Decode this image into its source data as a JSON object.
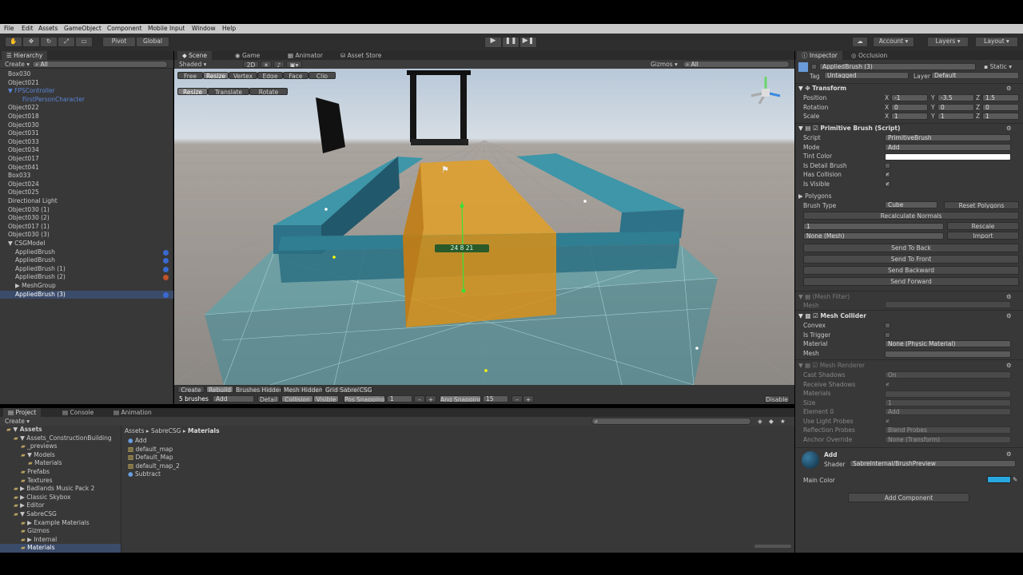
{
  "menu": [
    "File",
    "Edit",
    "Assets",
    "GameObject",
    "Component",
    "Mobile Input",
    "Window",
    "Help"
  ],
  "toolbar": {
    "pivot": "Pivot",
    "global": "Global",
    "account": "Account",
    "layers": "Layers",
    "layout": "Layout"
  },
  "hierarchy": {
    "tab": "Hierarchy",
    "create": "Create",
    "search_placeholder": "All",
    "items": [
      {
        "label": "Box030",
        "indent": 0,
        "style": "normal"
      },
      {
        "label": "Object021",
        "indent": 0,
        "style": "normal"
      },
      {
        "label": "▼ FPSController",
        "indent": 0,
        "style": "blue"
      },
      {
        "label": "FirstPersonCharacter",
        "indent": 2,
        "style": "blue"
      },
      {
        "label": "Object022",
        "indent": 0,
        "style": "normal"
      },
      {
        "label": "Object018",
        "indent": 0,
        "style": "normal"
      },
      {
        "label": "Object030",
        "indent": 0,
        "style": "normal"
      },
      {
        "label": "Object031",
        "indent": 0,
        "style": "normal"
      },
      {
        "label": "Object033",
        "indent": 0,
        "style": "normal"
      },
      {
        "label": "Object034",
        "indent": 0,
        "style": "normal"
      },
      {
        "label": "Object017",
        "indent": 0,
        "style": "normal"
      },
      {
        "label": "Object041",
        "indent": 0,
        "style": "normal"
      },
      {
        "label": "Box033",
        "indent": 0,
        "style": "normal"
      },
      {
        "label": "Object024",
        "indent": 0,
        "style": "normal"
      },
      {
        "label": "Object025",
        "indent": 0,
        "style": "normal"
      },
      {
        "label": "Directional Light",
        "indent": 0,
        "style": "normal"
      },
      {
        "label": "Object030 (1)",
        "indent": 0,
        "style": "normal"
      },
      {
        "label": "Object030 (2)",
        "indent": 0,
        "style": "normal"
      },
      {
        "label": "Object017 (1)",
        "indent": 0,
        "style": "normal"
      },
      {
        "label": "Object030 (3)",
        "indent": 0,
        "style": "normal"
      },
      {
        "label": "▼ CSGModel",
        "indent": 0,
        "style": "normal"
      },
      {
        "label": "AppliedBrush",
        "indent": 1,
        "style": "normal"
      },
      {
        "label": "AppliedBrush",
        "indent": 1,
        "style": "normal"
      },
      {
        "label": "AppliedBrush (1)",
        "indent": 1,
        "style": "normal"
      },
      {
        "label": "AppliedBrush (2)",
        "indent": 1,
        "style": "normal"
      },
      {
        "label": "▶ MeshGroup",
        "indent": 1,
        "style": "normal"
      },
      {
        "label": "AppliedBrush (3)",
        "indent": 1,
        "style": "selected"
      }
    ]
  },
  "scene": {
    "tabs": [
      "Scene",
      "Game",
      "Animator",
      "Asset Store"
    ],
    "shading": "Shaded",
    "mode_2d": "2D",
    "gizmos": "Gizmos",
    "search_placeholder": "All",
    "mode_tabs": [
      "Free",
      "Resize",
      "Vertex",
      "Edge",
      "Face",
      "Clip"
    ],
    "mode_tabs2": [
      "Resize",
      "Translate",
      "Rotate"
    ],
    "dimension_label": "24 8 21",
    "bottom_bar": [
      "Create",
      "Rebuild",
      "Brushes Hidden",
      "Mesh Hidden",
      "Grid Sabre(CSG)"
    ],
    "bottom_bar2": {
      "brushes": "5 brushes",
      "add": "Add",
      "detail": "Detail",
      "collision": "Collision",
      "visible": "Visible",
      "pos_snapping": "Pos Snapping",
      "pos_value": "1",
      "ang_snapping": "Ang Snapping",
      "ang_value": "15",
      "disable": "Disable"
    }
  },
  "project": {
    "tabs": [
      "Project",
      "Console",
      "Animation"
    ],
    "create": "Create",
    "breadcrumb": [
      "Assets",
      "SabreCSG",
      "Materials"
    ],
    "tree": [
      {
        "label": "▼ Assets",
        "indent": 0,
        "bold": true
      },
      {
        "label": "▼ Assets_ConstructionBuilding",
        "indent": 1
      },
      {
        "label": "_previews",
        "indent": 2
      },
      {
        "label": "▼ Models",
        "indent": 2
      },
      {
        "label": "Materials",
        "indent": 3
      },
      {
        "label": "Prefabs",
        "indent": 2
      },
      {
        "label": "Textures",
        "indent": 2
      },
      {
        "label": "▶ Badlands Music Pack 2",
        "indent": 1
      },
      {
        "label": "▶ Classic Skybox",
        "indent": 1
      },
      {
        "label": "▶ Editor",
        "indent": 1
      },
      {
        "label": "▼ SabreCSG",
        "indent": 1
      },
      {
        "label": "▶ Example Materials",
        "indent": 2
      },
      {
        "label": "Gizmos",
        "indent": 2
      },
      {
        "label": "▶ Internal",
        "indent": 2
      },
      {
        "label": "Materials",
        "indent": 2,
        "selected": true
      }
    ],
    "files": [
      "Add",
      "default_map",
      "Default_Map",
      "default_map_2",
      "Subtract"
    ]
  },
  "inspector": {
    "tabs": [
      "Inspector",
      "Occlusion"
    ],
    "object_name": "AppliedBrush (3)",
    "static": "Static",
    "tag_label": "Tag",
    "tag_value": "Untagged",
    "layer_label": "Layer",
    "layer_value": "Default",
    "transform": {
      "title": "Transform",
      "rows": [
        {
          "label": "Position",
          "x": "-1",
          "y": "-3.5",
          "z": "1.5"
        },
        {
          "label": "Rotation",
          "x": "0",
          "y": "0",
          "z": "0"
        },
        {
          "label": "Scale",
          "x": "1",
          "y": "1",
          "z": "1"
        }
      ]
    },
    "primitive": {
      "title": "Primitive Brush (Script)",
      "rows": [
        {
          "label": "Script",
          "value": "PrimitiveBrush"
        },
        {
          "label": "Mode",
          "value": "Add"
        },
        {
          "label": "Tint Color",
          "value": ""
        },
        {
          "label": "Is Detail Brush",
          "value": ""
        },
        {
          "label": "Has Collision",
          "value": "✓"
        },
        {
          "label": "Is Visible",
          "value": "✓"
        }
      ],
      "polygons": "Polygons",
      "brush_type_label": "Brush Type",
      "brush_type_value": "Cube",
      "reset_polygons": "Reset Polygons",
      "recalc_normals": "Recalculate Normals",
      "rescale": "Rescale",
      "rescale_value": "1",
      "mesh_value": "None (Mesh)",
      "import": "Import",
      "buttons": [
        "Send To Back",
        "Send To Front",
        "Send Backward",
        "Send Forward"
      ]
    },
    "mesh_filter": {
      "title": "(Mesh Filter)",
      "mesh_label": "Mesh"
    },
    "mesh_collider": {
      "title": "Mesh Collider",
      "rows": [
        {
          "label": "Convex",
          "value": ""
        },
        {
          "label": "Is Trigger",
          "value": ""
        },
        {
          "label": "Material",
          "value": "None (Physic Material)"
        },
        {
          "label": "Mesh",
          "value": ""
        }
      ]
    },
    "mesh_renderer": {
      "title": "Mesh Renderer",
      "rows": [
        {
          "label": "Cast Shadows",
          "value": "On"
        },
        {
          "label": "Receive Shadows",
          "value": "✓"
        },
        {
          "label": "Materials",
          "value": ""
        },
        {
          "label": "Size",
          "value": "1"
        },
        {
          "label": "Element 0",
          "value": "Add"
        },
        {
          "label": "Use Light Probes",
          "value": "✓"
        },
        {
          "label": "Reflection Probes",
          "value": "Blend Probes"
        },
        {
          "label": "Anchor Override",
          "value": "None (Transform)"
        }
      ]
    },
    "material": {
      "name": "Add",
      "shader_label": "Shader",
      "shader_value": "SabreInternal/BrushPreview",
      "main_color_label": "Main Color",
      "main_color": "#29a8e0"
    },
    "add_component": "Add Component"
  },
  "colors": {
    "panel": "#383838",
    "panel_dark": "#2b2b2b",
    "selection": "#3b4b6a",
    "accent_blue": "#5a86d6",
    "brush_teal": "#3a9fb0",
    "brush_orange": "#e6a020"
  }
}
